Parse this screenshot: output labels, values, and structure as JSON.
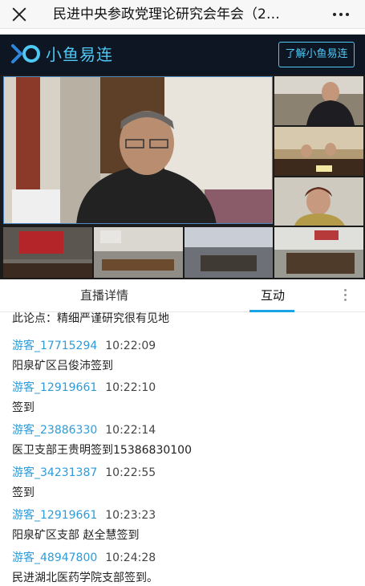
{
  "titlebar": {
    "title": "民进中央参政党理论研究会年会（2…"
  },
  "brand": {
    "name": "小鱼易连",
    "learn_button": "了解小鱼易连",
    "accent": "#4ec8f4"
  },
  "tabs": {
    "detail": "直播详情",
    "interact": "互动",
    "active": "互动"
  },
  "chat": {
    "first_line": "此论点：精细严谨研究很有见地",
    "messages": [
      {
        "user": "游客_17715294",
        "time": "10:22:09",
        "text": "阳泉矿区吕俊沛签到"
      },
      {
        "user": "游客_12919661",
        "time": "10:22:10",
        "text": "签到"
      },
      {
        "user": "游客_23886330",
        "time": "10:22:14",
        "text": "医卫支部王贵明签到15386830100"
      },
      {
        "user": "游客_34231387",
        "time": "10:22:55",
        "text": "签到"
      },
      {
        "user": "游客_12919661",
        "time": "10:23:23",
        "text": "阳泉矿区支部 赵全慧签到"
      },
      {
        "user": "游客_48947800",
        "time": "10:24:28",
        "text": "民进湖北医药学院支部签到。"
      }
    ]
  }
}
